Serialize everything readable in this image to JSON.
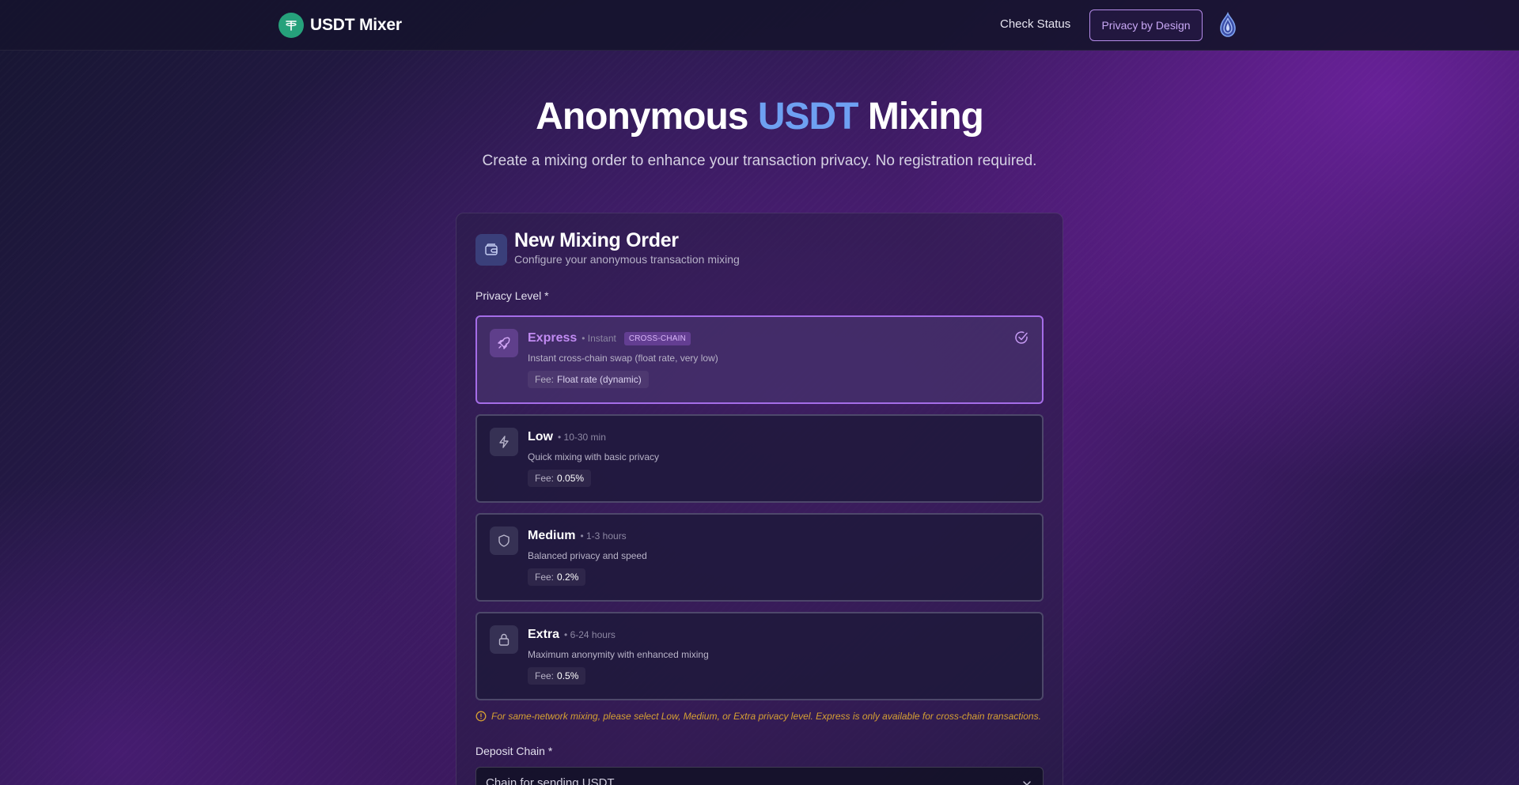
{
  "header": {
    "brand_name": "USDT Mixer",
    "nav_check_status": "Check Status",
    "nav_privacy_button": "Privacy by Design"
  },
  "hero": {
    "title_part1": "Anonymous ",
    "title_accent": "USDT",
    "title_part2": " Mixing",
    "subtitle": "Create a mixing order to enhance your transaction privacy. No registration required."
  },
  "card": {
    "title": "New Mixing Order",
    "subtitle": "Configure your anonymous transaction mixing",
    "privacy_label": "Privacy Level *",
    "options": [
      {
        "name": "Express",
        "time": "• Instant",
        "badge": "CROSS-CHAIN",
        "description": "Instant cross-chain swap (float rate, very low)",
        "fee_label": "Fee:",
        "fee_value": "Float rate (dynamic)",
        "icon": "rocket-icon",
        "selected": true
      },
      {
        "name": "Low",
        "time": "• 10-30 min",
        "description": "Quick mixing with basic privacy",
        "fee_label": "Fee:",
        "fee_value": "0.05%",
        "icon": "lightning-icon",
        "selected": false
      },
      {
        "name": "Medium",
        "time": "• 1-3 hours",
        "description": "Balanced privacy and speed",
        "fee_label": "Fee:",
        "fee_value": "0.2%",
        "icon": "shield-icon",
        "selected": false
      },
      {
        "name": "Extra",
        "time": "• 6-24 hours",
        "description": "Maximum anonymity with enhanced mixing",
        "fee_label": "Fee:",
        "fee_value": "0.5%",
        "icon": "lock-icon",
        "selected": false
      }
    ],
    "warning": "For same-network mixing, please select Low, Medium, or Extra privacy level. Express is only available for cross-chain transactions.",
    "deposit_chain_label": "Deposit Chain *",
    "deposit_chain_placeholder": "Chain for sending USDT"
  },
  "colors": {
    "accent_purple": "#a56de8",
    "accent_blue": "#6ea0f2",
    "brand_green": "#26a17b",
    "warning": "#d6a033"
  }
}
